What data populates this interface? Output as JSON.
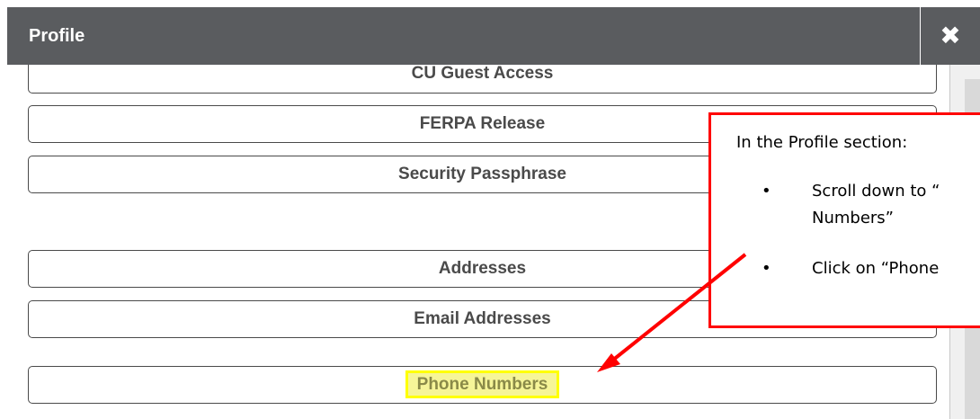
{
  "dialog": {
    "title": "Profile",
    "close_icon": "close-icon",
    "close_glyph": "✖"
  },
  "items": [
    {
      "label": "CU Guest Access"
    },
    {
      "label": "FERPA Release"
    },
    {
      "label": "Security Passphrase"
    },
    {
      "label": "Addresses"
    },
    {
      "label": "Email Addresses"
    },
    {
      "label": "Phone Numbers",
      "highlighted": true
    }
  ],
  "callout": {
    "title": "In the Profile section:",
    "bullet_glyph": "•",
    "bullets": [
      {
        "line1": "Scroll down to “",
        "line2": "Numbers”"
      },
      {
        "line1": "Click on “Phone"
      }
    ]
  },
  "colors": {
    "titlebar": "#5a5c5f",
    "callout_border": "#ff0000",
    "highlight": "#ffff00"
  }
}
